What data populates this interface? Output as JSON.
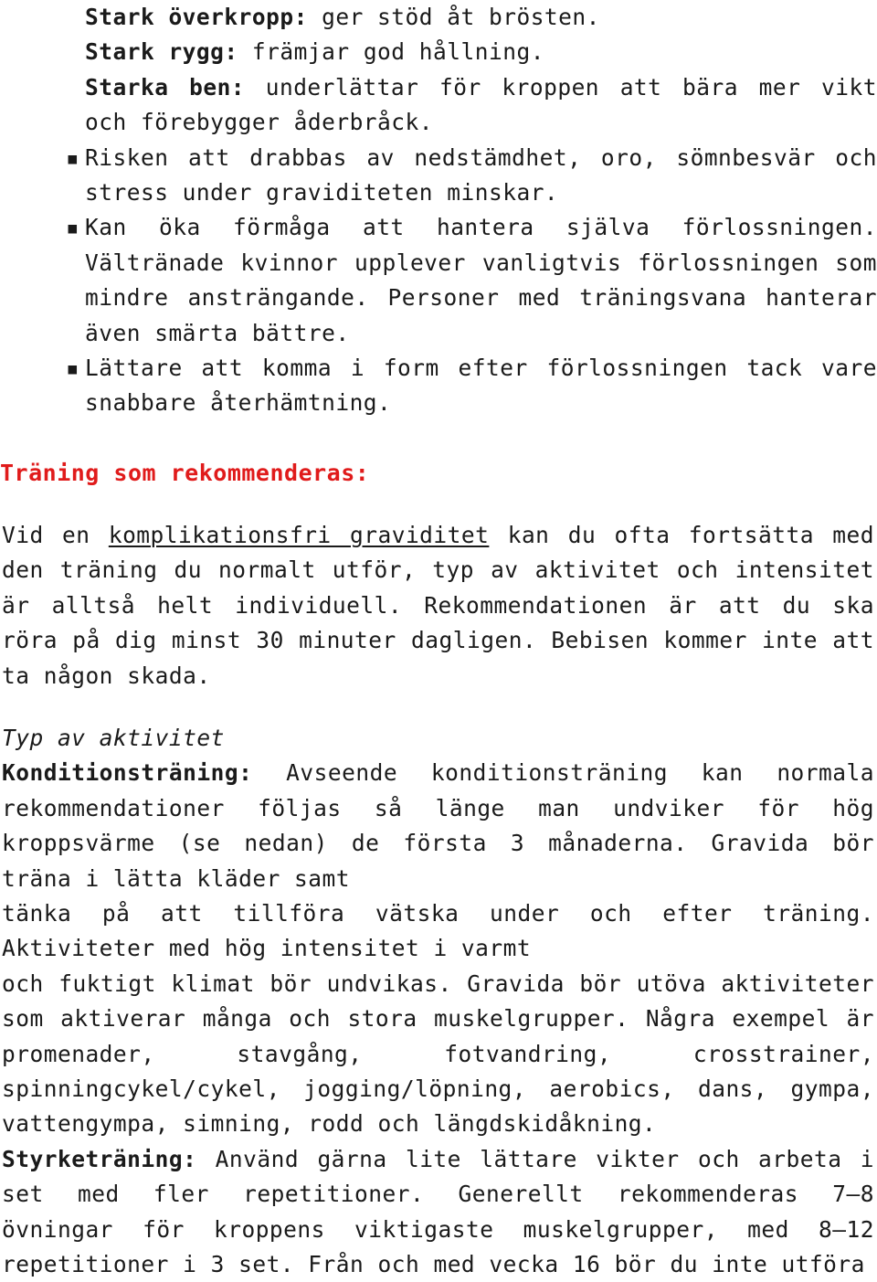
{
  "document": {
    "language": "sv",
    "accent_color": "#e01b1b",
    "text_color": "#1a1a1a",
    "background_color": "#ffffff",
    "bullet_glyph": "▪"
  },
  "benefits_list": {
    "items": [
      {
        "bullet": false,
        "lead": "Stark överkropp:",
        "lead_style": "bold",
        "text": " ger stöd åt brösten."
      },
      {
        "bullet": false,
        "lead": "Stark rygg:",
        "lead_style": "bold",
        "text": " främjar god hållning."
      },
      {
        "bullet": false,
        "lead": "Starka ben:",
        "lead_style": "bold",
        "text": " underlättar för kroppen att bära mer vikt och förebygger åderbråck."
      },
      {
        "bullet": true,
        "lead": "",
        "lead_style": "normal",
        "text": "Risken att drabbas av nedstämdhet, oro, sömnbesvär och stress under graviditeten minskar."
      },
      {
        "bullet": true,
        "lead": "",
        "lead_style": "normal",
        "text": "Kan öka förmåga att hantera själva förlossningen. Vältränade kvinnor upplever vanligtvis förlossningen som mindre ansträngande. Personer med träningsvana hanterar även smärta bättre."
      },
      {
        "bullet": true,
        "lead": "",
        "lead_style": "normal",
        "text": "Lättare att komma i form efter förlossningen tack vare snabbare återhämtning."
      }
    ]
  },
  "recommended_section": {
    "heading": "Träning som rekommenderas:",
    "intro_before_link": "Vid en ",
    "intro_link": "komplikationsfri graviditet",
    "intro_after_link": " kan du ofta fortsätta med den träning du normalt utför, typ av aktivitet och intensitet är alltså helt individuell. Rekommendationen är att du ska röra på dig minst 30 minuter dagligen. Bebisen kommer inte att ta någon skada."
  },
  "activity_section": {
    "subtitle": "Typ av aktivitet",
    "cardio": {
      "label": "Konditionsträning:",
      "paragraph_1": " Avseende konditionsträning kan normala rekommendationer följas så länge man undviker för hög kroppsvärme (se nedan) de första 3 månaderna. Gravida bör träna i lätta kläder samt",
      "paragraph_2": "tänka på att tillföra vätska under och efter träning. Aktiviteter med hög intensitet i varmt",
      "paragraph_3": "och fuktigt klimat bör undvikas. Gravida bör utöva aktiviteter som aktiverar många och stora muskelgrupper. Några exempel är promenader, stavgång, fotvandring, crosstrainer, spinningcykel/cykel, jogging/löpning, aerobics, dans, gympa, vattengympa, simning, rodd och längdskidåkning."
    },
    "strength": {
      "label": "Styrketräning:",
      "paragraph": " Använd gärna lite lättare vikter och arbeta i set med fler repetitioner. Generellt rekommenderas 7–8 övningar för kroppens viktigaste muskelgrupper, med 8–12 repetitioner i 3 set. Från och med vecka 16 bör du inte utföra"
    }
  }
}
